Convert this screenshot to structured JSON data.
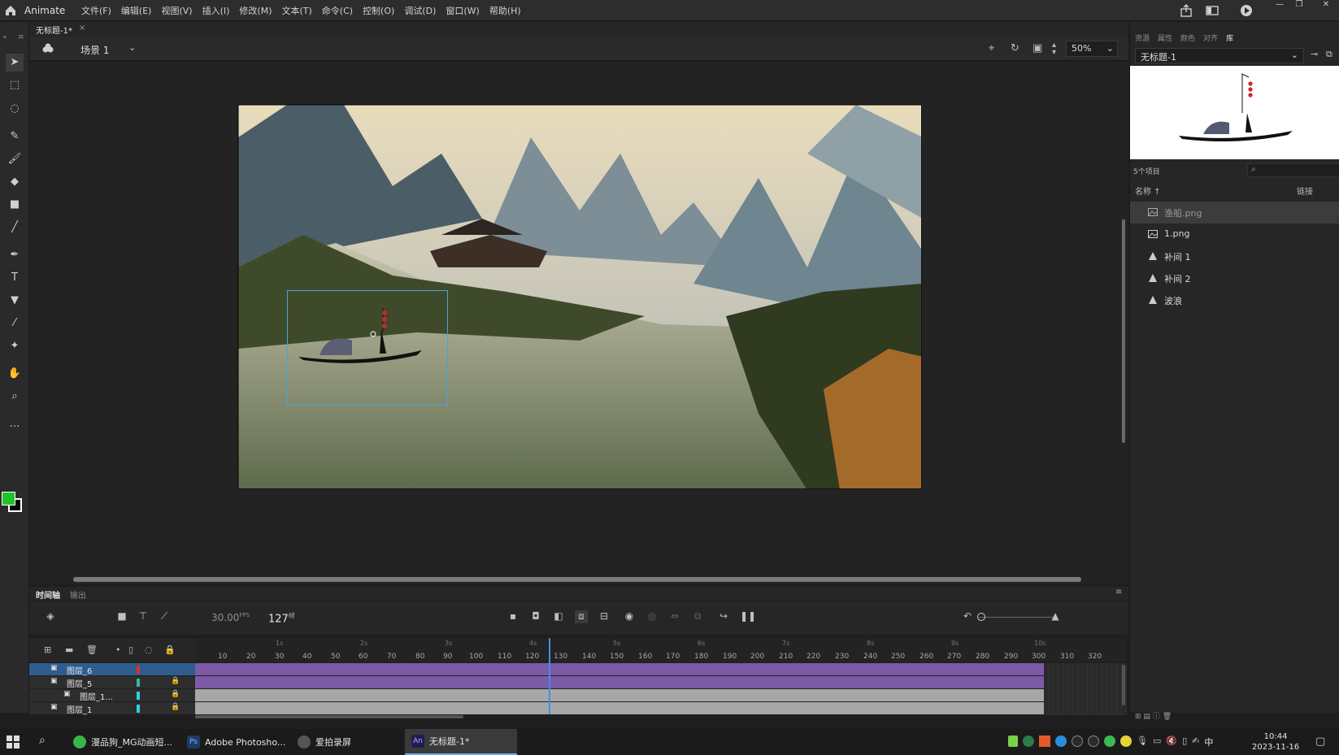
{
  "menubar": {
    "app_name": "Animate",
    "menus": [
      "文件(F)",
      "编辑(E)",
      "视图(V)",
      "插入(I)",
      "修改(M)",
      "文本(T)",
      "命令(C)",
      "控制(O)",
      "调试(D)",
      "窗口(W)",
      "帮助(H)"
    ]
  },
  "document": {
    "tab_label": "无标题-1*",
    "close_glyph": "×",
    "scene_label": "场景 1",
    "zoom": "50%"
  },
  "colors": {
    "fill": "#22c22a",
    "stroke": "#000000"
  },
  "right_panel": {
    "tabs": [
      "资源",
      "属性",
      "颜色",
      "对齐",
      "库"
    ],
    "active_tab": "库",
    "document_select": "无标题-1",
    "item_count": "5个项目",
    "column_name": "名称 ↑",
    "column_link": "链接",
    "items": [
      {
        "name": "渔船.png",
        "icon": "bitmap-icon"
      },
      {
        "name": "1.png",
        "icon": "bitmap-icon"
      },
      {
        "name": "补间 1",
        "icon": "graphic-symbol-icon"
      },
      {
        "name": "补间 2",
        "icon": "graphic-symbol-icon"
      },
      {
        "name": "波浪",
        "icon": "graphic-symbol-icon"
      }
    ]
  },
  "timeline": {
    "tab_timeline": "时间轴",
    "tab_output": "输出",
    "fps": "30.00",
    "fps_unit": "FPS",
    "current_frame": "127",
    "frame_unit": "帧",
    "seconds": [
      "1s",
      "2s",
      "3s",
      "4s",
      "5s",
      "6s",
      "7s",
      "8s",
      "9s",
      "10s"
    ],
    "frame_ticks": [
      "10",
      "20",
      "30",
      "40",
      "50",
      "60",
      "70",
      "80",
      "90",
      "100",
      "110",
      "120",
      "130",
      "140",
      "150",
      "160",
      "170",
      "180",
      "190",
      "200",
      "210",
      "220",
      "230",
      "240",
      "250",
      "260",
      "270",
      "280",
      "290",
      "300",
      "310",
      "320"
    ],
    "layers": [
      {
        "name": "图层_6",
        "color": "#e0302a",
        "locked": false,
        "selected": true
      },
      {
        "name": "图层_5",
        "color": "#2fb8a0",
        "locked": true,
        "selected": false
      },
      {
        "name": "图层_1...",
        "color": "#30d0e0",
        "locked": true,
        "selected": false
      },
      {
        "name": "图层_1",
        "color": "#30d0e0",
        "locked": true,
        "selected": false
      }
    ]
  },
  "taskbar": {
    "apps": [
      {
        "label": "漫品狗_MG动画短...",
        "color": "#39b54a"
      },
      {
        "label": "Adobe Photosho...",
        "color": "#1f3b66"
      },
      {
        "label": "爱拍录屏",
        "color": "#555555"
      },
      {
        "label": "无标题-1*",
        "color": "#1f1d54"
      }
    ],
    "time": "10:44",
    "date": "2023-11-16",
    "ime": "中"
  }
}
